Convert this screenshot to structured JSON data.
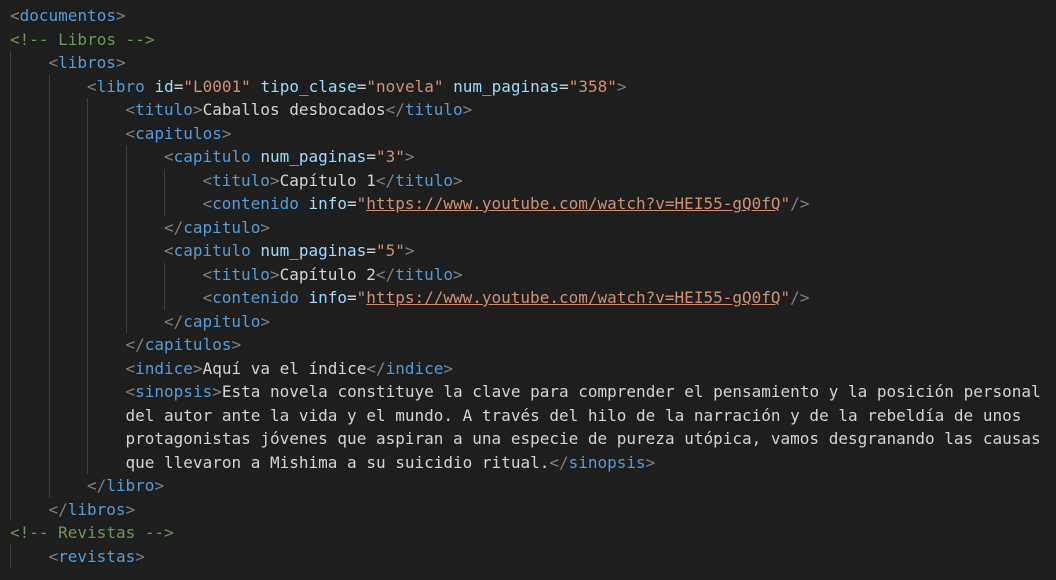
{
  "lines": [
    {
      "indent": 0,
      "tokens": [
        [
          "br",
          "<"
        ],
        [
          "tag",
          "documentos"
        ],
        [
          "br",
          ">"
        ]
      ]
    },
    {
      "indent": 0,
      "tokens": [
        [
          "cmt",
          "<!-- Libros -->"
        ]
      ]
    },
    {
      "indent": 1,
      "tokens": [
        [
          "br",
          "<"
        ],
        [
          "tag",
          "libros"
        ],
        [
          "br",
          ">"
        ]
      ]
    },
    {
      "indent": 2,
      "tokens": [
        [
          "br",
          "<"
        ],
        [
          "tag",
          "libro"
        ],
        [
          "txt",
          " "
        ],
        [
          "attr",
          "id"
        ],
        [
          "txt",
          "="
        ],
        [
          "val",
          "\"L0001\""
        ],
        [
          "txt",
          " "
        ],
        [
          "attr",
          "tipo_clase"
        ],
        [
          "txt",
          "="
        ],
        [
          "val",
          "\"novela\""
        ],
        [
          "txt",
          " "
        ],
        [
          "attr",
          "num_paginas"
        ],
        [
          "txt",
          "="
        ],
        [
          "val",
          "\"358\""
        ],
        [
          "br",
          ">"
        ]
      ]
    },
    {
      "indent": 3,
      "tokens": [
        [
          "br",
          "<"
        ],
        [
          "tag",
          "titulo"
        ],
        [
          "br",
          ">"
        ],
        [
          "txt",
          "Caballos desbocados"
        ],
        [
          "br",
          "</"
        ],
        [
          "tag",
          "titulo"
        ],
        [
          "br",
          ">"
        ]
      ]
    },
    {
      "indent": 3,
      "tokens": [
        [
          "br",
          "<"
        ],
        [
          "tag",
          "capitulos"
        ],
        [
          "br",
          ">"
        ]
      ]
    },
    {
      "indent": 4,
      "tokens": [
        [
          "br",
          "<"
        ],
        [
          "tag",
          "capitulo"
        ],
        [
          "txt",
          " "
        ],
        [
          "attr",
          "num_paginas"
        ],
        [
          "txt",
          "="
        ],
        [
          "val",
          "\"3\""
        ],
        [
          "br",
          ">"
        ]
      ]
    },
    {
      "indent": 5,
      "tokens": [
        [
          "br",
          "<"
        ],
        [
          "tag",
          "titulo"
        ],
        [
          "br",
          ">"
        ],
        [
          "txt",
          "Capítulo 1"
        ],
        [
          "br",
          "</"
        ],
        [
          "tag",
          "titulo"
        ],
        [
          "br",
          ">"
        ]
      ]
    },
    {
      "indent": 5,
      "tokens": [
        [
          "br",
          "<"
        ],
        [
          "tag",
          "contenido"
        ],
        [
          "txt",
          " "
        ],
        [
          "attr",
          "info"
        ],
        [
          "txt",
          "="
        ],
        [
          "val",
          "\""
        ],
        [
          "link",
          "https://www.youtube.com/watch?v=HEI55-gQ0fQ"
        ],
        [
          "val",
          "\""
        ],
        [
          "br",
          "/>"
        ]
      ]
    },
    {
      "indent": 4,
      "tokens": [
        [
          "br",
          "</"
        ],
        [
          "tag",
          "capitulo"
        ],
        [
          "br",
          ">"
        ]
      ]
    },
    {
      "indent": 4,
      "tokens": [
        [
          "br",
          "<"
        ],
        [
          "tag",
          "capitulo"
        ],
        [
          "txt",
          " "
        ],
        [
          "attr",
          "num_paginas"
        ],
        [
          "txt",
          "="
        ],
        [
          "val",
          "\"5\""
        ],
        [
          "br",
          ">"
        ]
      ]
    },
    {
      "indent": 5,
      "tokens": [
        [
          "br",
          "<"
        ],
        [
          "tag",
          "titulo"
        ],
        [
          "br",
          ">"
        ],
        [
          "txt",
          "Capítulo 2"
        ],
        [
          "br",
          "</"
        ],
        [
          "tag",
          "titulo"
        ],
        [
          "br",
          ">"
        ]
      ]
    },
    {
      "indent": 5,
      "tokens": [
        [
          "br",
          "<"
        ],
        [
          "tag",
          "contenido"
        ],
        [
          "txt",
          " "
        ],
        [
          "attr",
          "info"
        ],
        [
          "txt",
          "="
        ],
        [
          "val",
          "\""
        ],
        [
          "link",
          "https://www.youtube.com/watch?v=HEI55-gQ0fQ"
        ],
        [
          "val",
          "\""
        ],
        [
          "br",
          "/>"
        ]
      ]
    },
    {
      "indent": 4,
      "tokens": [
        [
          "br",
          "</"
        ],
        [
          "tag",
          "capitulo"
        ],
        [
          "br",
          ">"
        ]
      ]
    },
    {
      "indent": 3,
      "tokens": [
        [
          "br",
          "</"
        ],
        [
          "tag",
          "capitulos"
        ],
        [
          "br",
          ">"
        ]
      ]
    },
    {
      "indent": 3,
      "tokens": [
        [
          "br",
          "<"
        ],
        [
          "tag",
          "indice"
        ],
        [
          "br",
          ">"
        ],
        [
          "txt",
          "Aquí va el índice"
        ],
        [
          "br",
          "</"
        ],
        [
          "tag",
          "indice"
        ],
        [
          "br",
          ">"
        ]
      ]
    },
    {
      "indent": 3,
      "tokens": [
        [
          "br",
          "<"
        ],
        [
          "tag",
          "sinopsis"
        ],
        [
          "br",
          ">"
        ],
        [
          "txt",
          "Esta novela constituye la clave para comprender el pensamiento y la posición personal"
        ]
      ]
    },
    {
      "indent": 3,
      "tokens": [
        [
          "txt",
          "del autor ante la vida y el mundo. A través del hilo de la narración y de la rebeldía de unos"
        ]
      ]
    },
    {
      "indent": 3,
      "tokens": [
        [
          "txt",
          "protagonistas jóvenes que aspiran a una especie de pureza utópica, vamos desgranando las causas"
        ]
      ]
    },
    {
      "indent": 3,
      "tokens": [
        [
          "txt",
          "que llevaron a Mishima a su suicidio ritual."
        ],
        [
          "br",
          "</"
        ],
        [
          "tag",
          "sinopsis"
        ],
        [
          "br",
          ">"
        ]
      ]
    },
    {
      "indent": 2,
      "tokens": [
        [
          "br",
          "</"
        ],
        [
          "tag",
          "libro"
        ],
        [
          "br",
          ">"
        ]
      ]
    },
    {
      "indent": 1,
      "tokens": [
        [
          "br",
          "</"
        ],
        [
          "tag",
          "libros"
        ],
        [
          "br",
          ">"
        ]
      ]
    },
    {
      "indent": 0,
      "tokens": [
        [
          "cmt",
          "<!-- Revistas -->"
        ]
      ]
    },
    {
      "indent": 1,
      "tokens": [
        [
          "br",
          "<"
        ],
        [
          "tag",
          "revistas"
        ],
        [
          "br",
          ">"
        ]
      ]
    }
  ]
}
